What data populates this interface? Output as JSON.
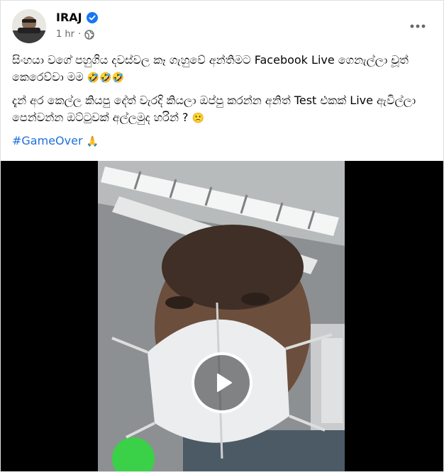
{
  "post": {
    "author": "IRAJ",
    "time": "1 hr",
    "separator": "·",
    "line1": "සිංහයා වගේ පහුගිය දවස්වල කෑ ගැහුවේ අන්තිමට Facebook Live ගෙනැල්ලා චූත් කෙරෙව්වා මම",
    "line1_emoji": "🤣🤣🤣",
    "line2": "දැන් අර කෙල්ල කියපු දේත් වැරදි කියලා ඔප්පු කරන්න අනිත් Test එකක් Live ඇවිල්ලා පෙන්වන්න ඔට්ටුවක් අල්ලමුද හරින් ?",
    "line2_emoji": "🙁",
    "hashtag": "#GameOver",
    "hashtag_emoji": "🙏"
  },
  "icons": {
    "verified": "verified-badge-icon",
    "privacy": "globe-icon",
    "more": "more-options-icon",
    "play": "play-icon"
  },
  "colors": {
    "link": "#216fdb",
    "verified": "#1877f2",
    "secondary_text": "#65676b"
  }
}
